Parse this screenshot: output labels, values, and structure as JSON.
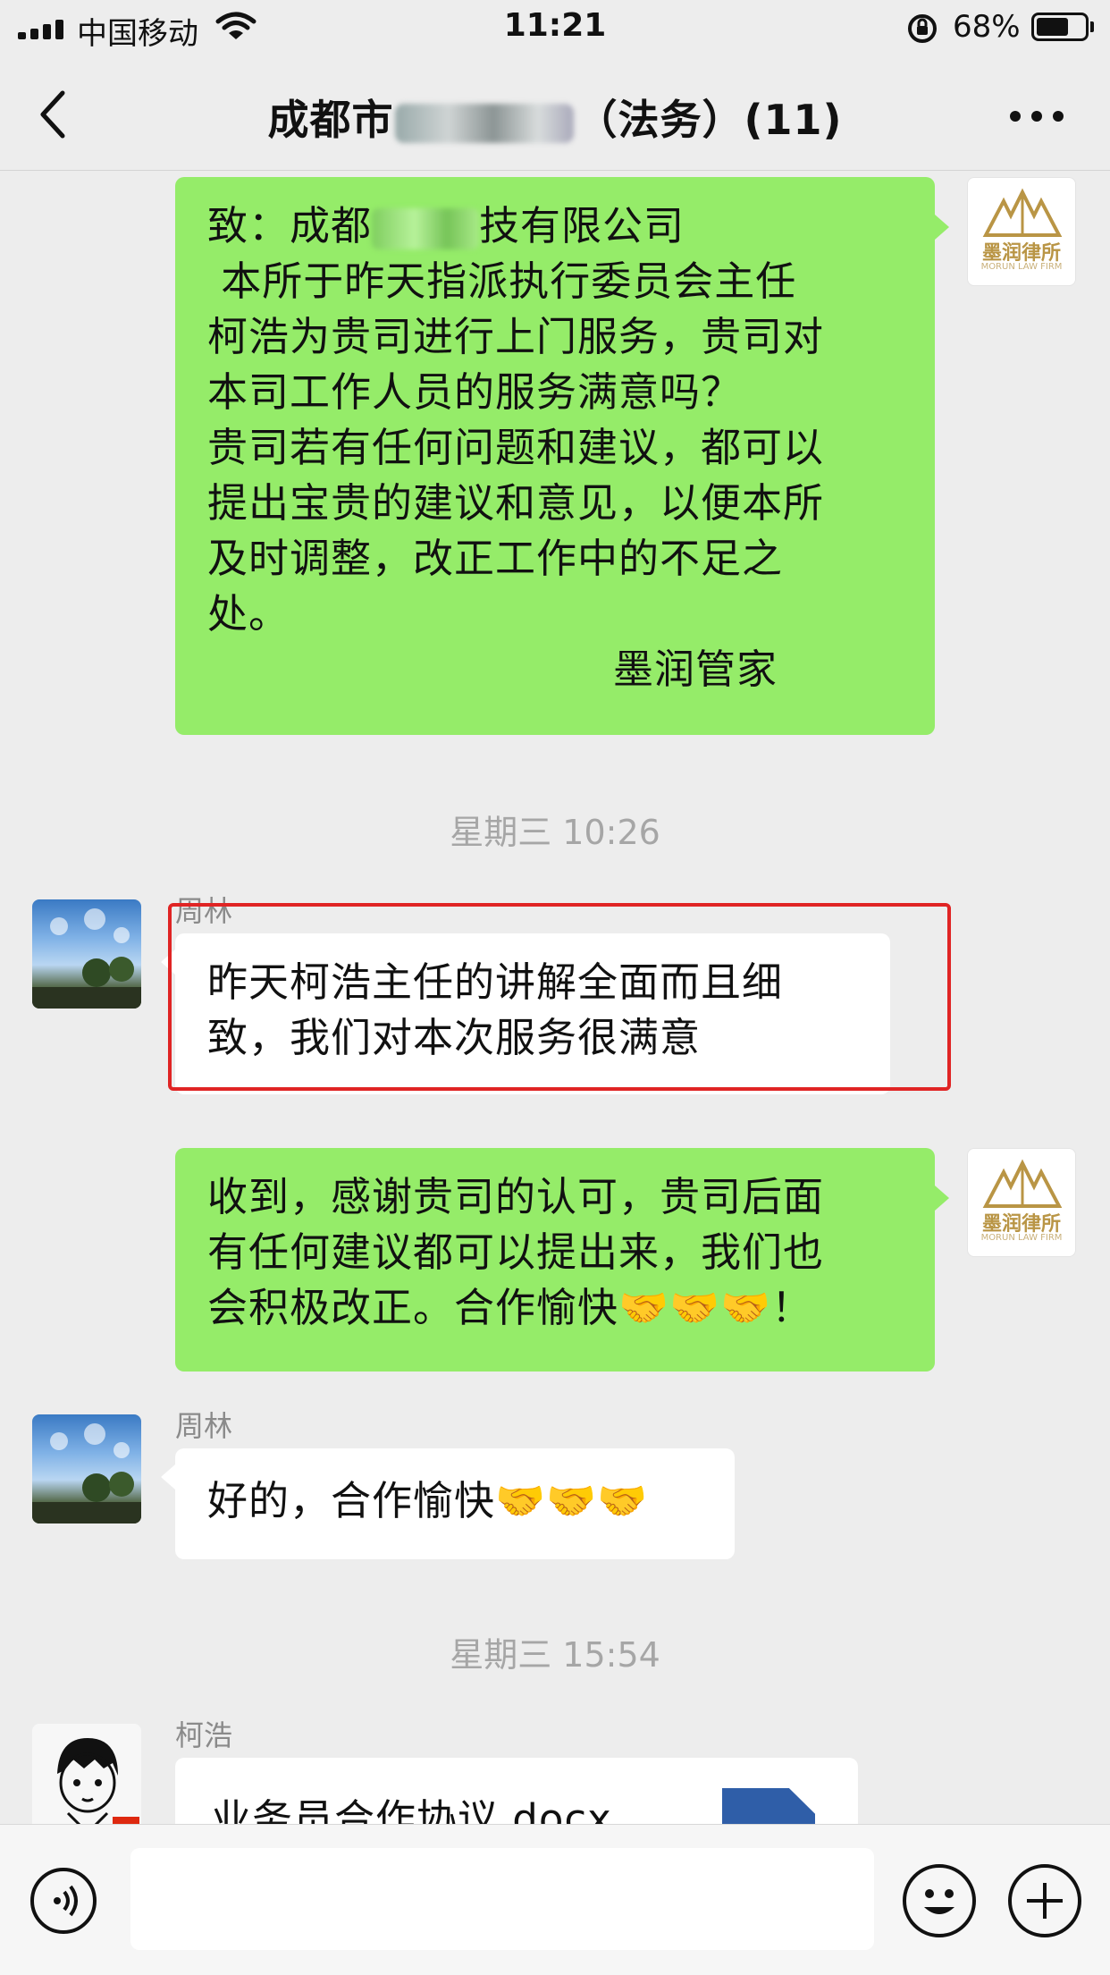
{
  "status_bar": {
    "carrier": "中国移动",
    "time": "11:21",
    "battery_percent": "68%",
    "battery_level": 0.68,
    "icons": [
      "signal-icon",
      "wifi-icon",
      "rotation-lock-icon",
      "battery-icon"
    ]
  },
  "nav": {
    "title_prefix": "成都市",
    "title_suffix": "（法务）(11)",
    "back_icon": "chevron-left-icon",
    "more_icon": "more-icon"
  },
  "messages": {
    "m1": {
      "line1_prefix": "致：成都",
      "line1_suffix": "技有限公司",
      "lines": [
        " 本所于昨天指派执行委员会主任",
        "柯浩为贵司进行上门服务，贵司对",
        "本司工作人员的服务满意吗？",
        "贵司若有任何问题和建议，都可以",
        "提出宝贵的建议和意见，以便本所",
        "及时调整，改正工作中的不足之",
        "处。"
      ],
      "signature": "墨润管家"
    },
    "ts1": "星期三 10:26",
    "m2": {
      "sender": "周林",
      "lines": [
        "昨天柯浩主任的讲解全面而且细",
        "致，我们对本次服务很满意"
      ]
    },
    "m3": {
      "lines": [
        "收到，感谢贵司的认可，贵司后面",
        "有任何建议都可以提出来，我们也",
        "会积极改正。合作愉快🤝🤝🤝！"
      ]
    },
    "m4": {
      "sender": "周林",
      "text": "好的，合作愉快🤝🤝🤝"
    },
    "ts2": "星期三 15:54",
    "m5": {
      "sender": "柯浩",
      "file_name": "业务员合作协议.docx",
      "file_icon": "word-document-icon"
    }
  },
  "law_logo": {
    "name": "墨润律所",
    "sub": "MORUN LAW FIRM",
    "color": "#b99545"
  },
  "input_bar": {
    "placeholder": "",
    "icons": [
      "voice-icon",
      "emoji-icon",
      "plus-icon"
    ]
  },
  "colors": {
    "my_bubble": "#95ec69",
    "their_bubble": "#ffffff",
    "background": "#ededed",
    "highlight": "#e02424"
  }
}
